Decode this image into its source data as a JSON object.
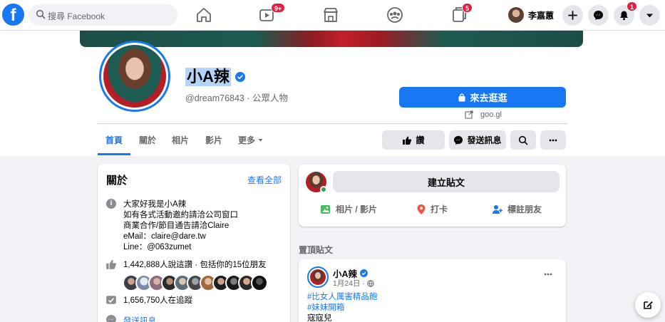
{
  "topbar": {
    "logo": "f",
    "search_placeholder": "搜尋 Facebook",
    "watch_badge": "9+",
    "pages_badge": "5",
    "notif_badge": "1",
    "user_name": "李嘉蕙"
  },
  "profile": {
    "name": "小A辣",
    "handle": "@dream76843 · 公眾人物",
    "shop_button": "來去逛逛",
    "link": "goo.gl"
  },
  "tabs": [
    {
      "label": "首頁"
    },
    {
      "label": "關於"
    },
    {
      "label": "相片"
    },
    {
      "label": "影片"
    },
    {
      "label": "更多"
    }
  ],
  "actions": {
    "like": "讚",
    "message": "發送訊息"
  },
  "about": {
    "title": "關於",
    "see_all": "查看全部",
    "bio": [
      "大家好我是小A辣",
      "如有各式活動邀約請洽公司窗口",
      "商業合作/節目通告請洽Claire",
      "eMail：claire@dare.tw",
      "Line：@063zumet"
    ],
    "likes": "1,442,888人說這讚 · 包括你的15位朋友",
    "follows": "1,656,750人在追蹤",
    "send_message": "發送訊息"
  },
  "composer": {
    "create_post": "建立貼文",
    "photo_video": "相片 / 影片",
    "check_in": "打卡",
    "tag_friends": "標註朋友"
  },
  "pinned": {
    "label": "置頂貼文",
    "author": "小A辣",
    "date": "1月24日 ·",
    "hashtag1": "#比女人厲害精品飽",
    "hashtag2": "#妹妹開箱",
    "text": "寇寇兒"
  },
  "colors": {
    "brand": "#1877f2",
    "badge": "#e41e3f",
    "online": "#31a24c"
  }
}
